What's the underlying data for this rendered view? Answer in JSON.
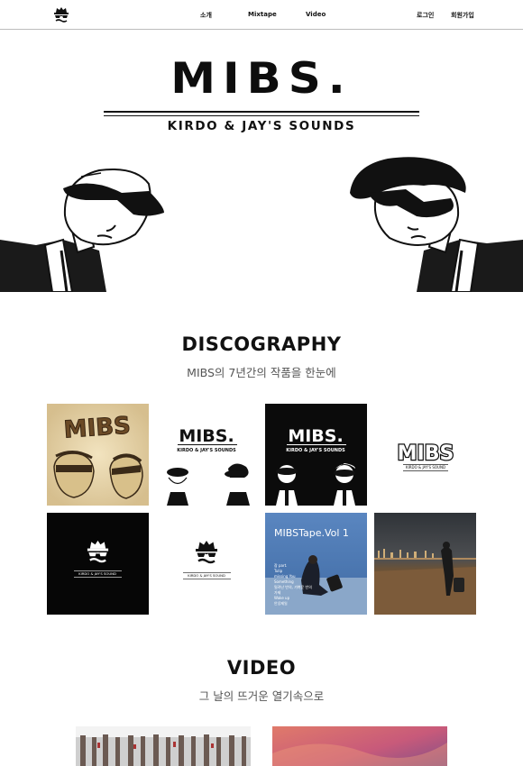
{
  "header": {
    "logo_icon": "sunglasses-face-logo",
    "nav": [
      {
        "label": "소개"
      },
      {
        "label": "Mixtape"
      },
      {
        "label": "Video"
      }
    ],
    "login_label": "로그인",
    "signup_label": "회원가입"
  },
  "hero": {
    "title": "MIBS.",
    "subtitle": "KIRDO & JAY'S SOUNDS"
  },
  "discography": {
    "title": "DISCOGRAPHY",
    "subtitle": "MIBS의 7년간의 작품을 한눈에",
    "albums": [
      {
        "name": "album-1",
        "cover_text": "MIBS"
      },
      {
        "name": "album-2",
        "cover_text": "MIBS.",
        "cover_sub": "KIRDO & JAY'S SOUNDS"
      },
      {
        "name": "album-3",
        "cover_text": "MIBS.",
        "cover_sub": "KIRDO & JAY'S SOUNDS"
      },
      {
        "name": "album-4",
        "cover_text": "MIBS",
        "cover_sub": "KIRDO & JAY'S SOUND"
      },
      {
        "name": "album-5",
        "cover_sub": "KIRDO & JAY'S SOUND"
      },
      {
        "name": "album-6",
        "cover_sub": "KIRDO & JAY'S SOUND"
      },
      {
        "name": "album-7",
        "cover_text": "MIBSTape.Vol 1",
        "tracklist": [
          "잠 part.",
          "Tulip",
          "missing You",
          "Something",
          "밀려난 반의, 가벼운 반의",
          "가제",
          "Wake up",
          "안녕제일"
        ]
      },
      {
        "name": "album-8"
      }
    ]
  },
  "video": {
    "title": "VIDEO",
    "subtitle": "그 날의 뜨거운 열기속으로"
  },
  "colors": {
    "text": "#111111",
    "subtitle": "#555555",
    "border": "#bdbdbd",
    "cover_blue": "#4f7bb5"
  }
}
